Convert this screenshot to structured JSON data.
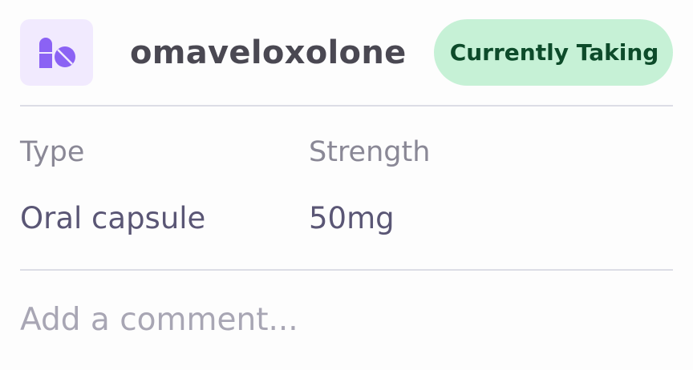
{
  "medication": {
    "name": "omaveloxolone",
    "icon": "pills-icon",
    "icon_color": "#8b62f4",
    "icon_bg": "#f1eafe"
  },
  "status": {
    "label": "Currently Taking",
    "bg_color": "#c6f1d6",
    "text_color": "#0d4b2a"
  },
  "details": {
    "type_label": "Type",
    "type_value": "Oral capsule",
    "strength_label": "Strength",
    "strength_value": "50mg"
  },
  "comment": {
    "placeholder": "Add a comment..."
  }
}
